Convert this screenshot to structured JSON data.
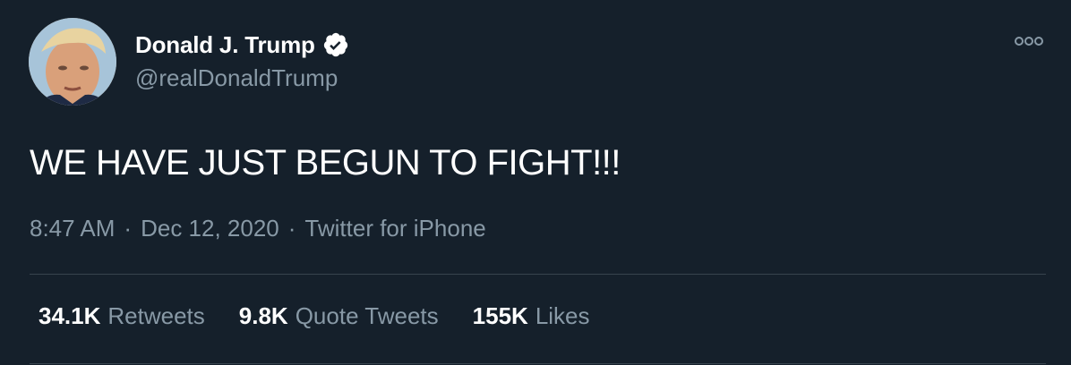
{
  "author": {
    "display_name": "Donald J. Trump",
    "handle": "@realDonaldTrump",
    "verified": true
  },
  "tweet": {
    "text": "WE HAVE JUST BEGUN TO FIGHT!!!",
    "time": "8:47 AM",
    "date": "Dec 12, 2020",
    "source": "Twitter for iPhone",
    "separator": "·"
  },
  "stats": [
    {
      "value": "34.1K",
      "label": "Retweets"
    },
    {
      "value": "9.8K",
      "label": "Quote Tweets"
    },
    {
      "value": "155K",
      "label": "Likes"
    }
  ],
  "icons": {
    "avatar": "avatar",
    "verified": "verified-badge-icon",
    "more": "more-options-icon"
  },
  "colors": {
    "background": "#15202b",
    "primary_text": "#ffffff",
    "secondary_text": "#8899a6",
    "divider": "#38444d"
  }
}
